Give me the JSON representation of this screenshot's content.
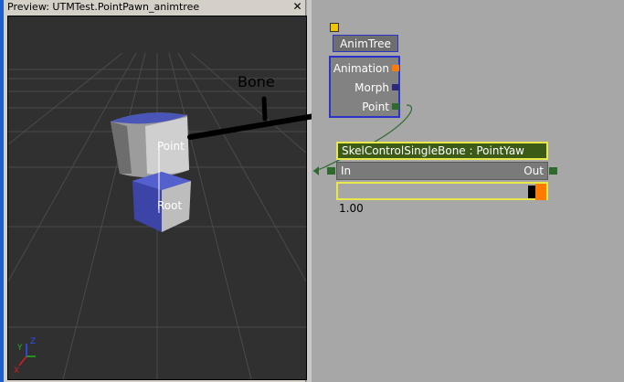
{
  "preview": {
    "title": "Preview: UTMTest.PointPawn_animtree",
    "close_label": "✕",
    "bone_labels": {
      "point": "Point",
      "root": "Root"
    },
    "annotation": "Bone",
    "axis": {
      "x": "X",
      "y": "Y",
      "z": "Z"
    }
  },
  "anim_tree": {
    "title": "AnimTree",
    "pins": [
      {
        "label": "Animation",
        "color": "#ff7a00"
      },
      {
        "label": "Morph",
        "color": "#2b2b7a"
      },
      {
        "label": "Point",
        "color": "#2d6b2d"
      }
    ]
  },
  "skel_control": {
    "title": "SkelControlSingleBone : PointYaw",
    "in_label": "In",
    "out_label": "Out",
    "value_text": "1.00",
    "strength": 1.0
  },
  "colors": {
    "accent_yellow": "#e8e84a",
    "node_border": "#2b34c7",
    "pin_green": "#2d6b2d",
    "pin_orange": "#ff7a00"
  }
}
